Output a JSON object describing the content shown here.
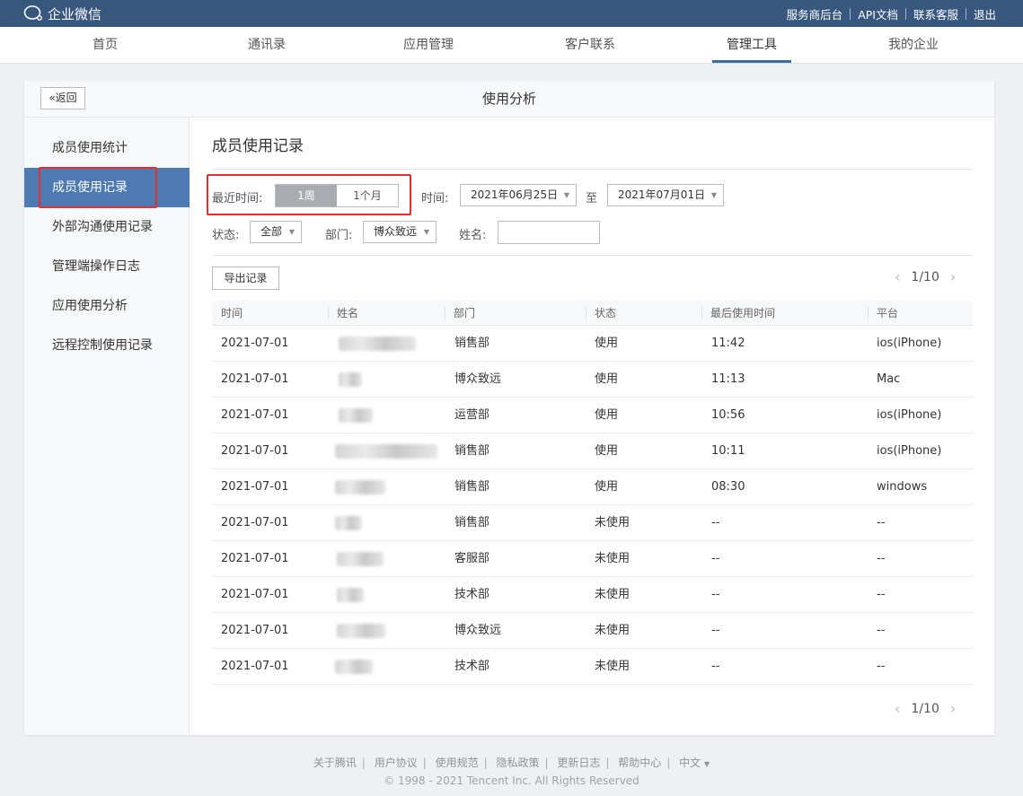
{
  "topbar": {
    "logo_text": "企业微信",
    "links": [
      "服务商后台",
      "API文档",
      "联系客服",
      "退出"
    ]
  },
  "mainnav": {
    "items": [
      "首页",
      "通讯录",
      "应用管理",
      "客户联系",
      "管理工具",
      "我的企业"
    ],
    "active": "管理工具"
  },
  "page": {
    "back_label": "返回",
    "title": "使用分析"
  },
  "sidebar": {
    "items": [
      "成员使用统计",
      "成员使用记录",
      "外部沟通使用记录",
      "管理端操作日志",
      "应用使用分析",
      "远程控制使用记录"
    ],
    "active": "成员使用记录"
  },
  "content": {
    "title": "成员使用记录",
    "filters": {
      "recent_label": "最近时间:",
      "recent_options": [
        "1周",
        "1个月"
      ],
      "recent_selected": "1周",
      "time_label": "时间:",
      "date_from": "2021年06月25日",
      "to_label": "至",
      "date_to": "2021年07月01日",
      "status_label": "状态:",
      "status_value": "全部",
      "dept_label": "部门:",
      "dept_value": "博众致远",
      "name_label": "姓名:",
      "name_value": ""
    },
    "export_label": "导出记录",
    "pager_text": "1/10"
  },
  "table": {
    "headers": [
      "时间",
      "姓名",
      "部门",
      "状态",
      "最后使用时间",
      "平台"
    ],
    "rows": [
      {
        "time": "2021-07-01",
        "dept": "销售部",
        "status": "使用",
        "last": "11:42",
        "platform": "ios(iPhone)"
      },
      {
        "time": "2021-07-01",
        "dept": "博众致远",
        "status": "使用",
        "last": "11:13",
        "platform": "Mac"
      },
      {
        "time": "2021-07-01",
        "dept": "运营部",
        "status": "使用",
        "last": "10:56",
        "platform": "ios(iPhone)"
      },
      {
        "time": "2021-07-01",
        "dept": "销售部",
        "status": "使用",
        "last": "10:11",
        "platform": "ios(iPhone)"
      },
      {
        "time": "2021-07-01",
        "dept": "销售部",
        "status": "使用",
        "last": "08:30",
        "platform": "windows"
      },
      {
        "time": "2021-07-01",
        "dept": "销售部",
        "status": "未使用",
        "last": "--",
        "platform": "--"
      },
      {
        "time": "2021-07-01",
        "dept": "客服部",
        "status": "未使用",
        "last": "--",
        "platform": "--"
      },
      {
        "time": "2021-07-01",
        "dept": "技术部",
        "status": "未使用",
        "last": "--",
        "platform": "--"
      },
      {
        "time": "2021-07-01",
        "dept": "博众致远",
        "status": "未使用",
        "last": "--",
        "platform": "--"
      },
      {
        "time": "2021-07-01",
        "dept": "技术部",
        "status": "未使用",
        "last": "--",
        "platform": "--"
      }
    ]
  },
  "footer": {
    "links": [
      "关于腾讯",
      "用户协议",
      "使用规范",
      "隐私政策",
      "更新日志",
      "帮助中心",
      "中文"
    ],
    "copyright": "© 1998 - 2021 Tencent Inc. All Rights Reserved"
  },
  "colors": {
    "topbar": "#38577f",
    "sidebar_active": "#4d7ab3",
    "highlight": "#e03030"
  }
}
